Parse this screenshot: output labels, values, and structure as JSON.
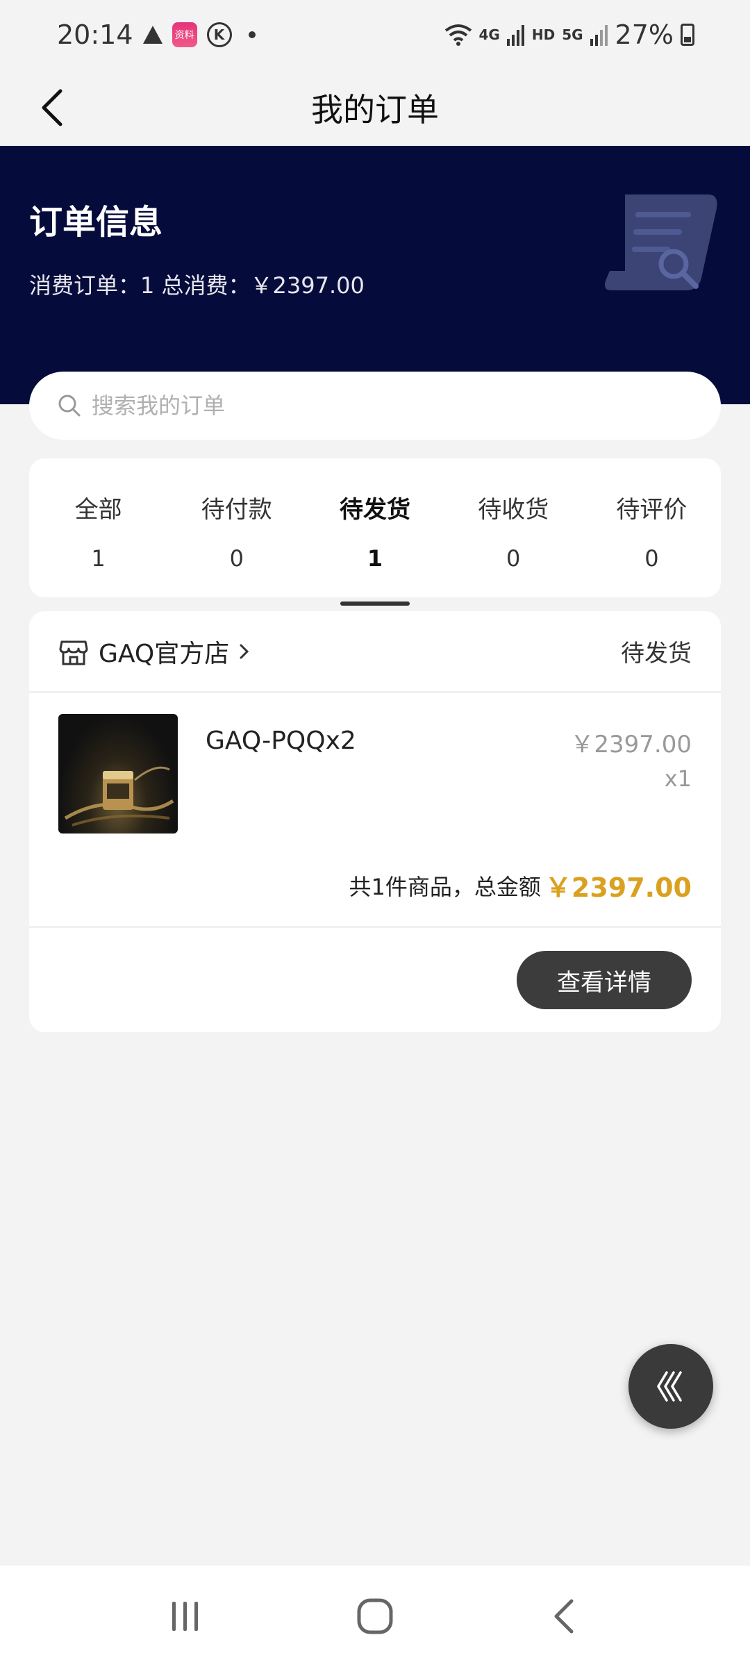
{
  "status_bar": {
    "time": "20:14",
    "app_badge_text": "资料",
    "k_icon_text": "K",
    "network_4g": "4G",
    "network_hd": "HD",
    "network_5g": "5G",
    "battery": "27%"
  },
  "header": {
    "title": "我的订单"
  },
  "banner": {
    "title": "订单信息",
    "summary": "消费订单：1 总消费：￥2397.00"
  },
  "search": {
    "placeholder": "搜索我的订单"
  },
  "tabs": [
    {
      "label": "全部",
      "count": "1"
    },
    {
      "label": "待付款",
      "count": "0"
    },
    {
      "label": "待发货",
      "count": "1"
    },
    {
      "label": "待收货",
      "count": "0"
    },
    {
      "label": "待评价",
      "count": "0"
    }
  ],
  "active_tab_index": 2,
  "order": {
    "store_name": "GAQ官方店",
    "status": "待发货",
    "product_name": "GAQ-PQQx2",
    "price": "￥2397.00",
    "quantity": "x1",
    "total_text": "共1件商品，总金额",
    "total_amount": "￥2397.00",
    "details_button": "查看详情"
  },
  "colors": {
    "banner_bg": "#050b3b",
    "accent_gold": "#d9a11f",
    "button_dark": "#3c3c3c"
  }
}
